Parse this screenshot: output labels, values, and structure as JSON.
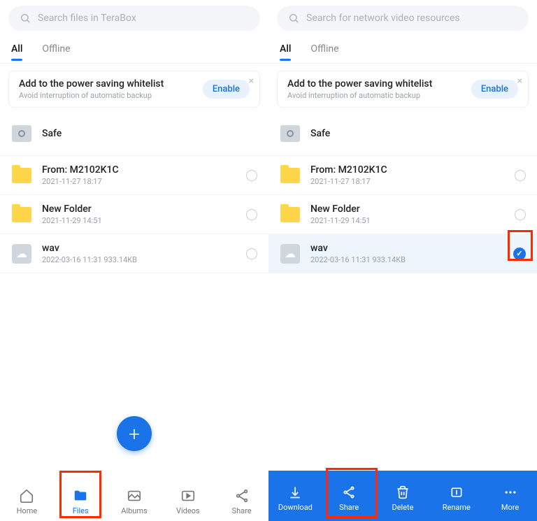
{
  "left": {
    "search_placeholder": "Search files in TeraBox",
    "tabs": {
      "all": "All",
      "offline": "Offline"
    },
    "banner": {
      "title": "Add to the power saving whitelist",
      "subtitle": "Avoid interruption of automatic backup",
      "button": "Enable"
    },
    "safe": {
      "title": "Safe"
    },
    "items": [
      {
        "title": "From: M2102K1C",
        "meta": "2021-11-27  18:17"
      },
      {
        "title": "New Folder",
        "meta": "2021-11-29  14:51"
      },
      {
        "title": "wav",
        "meta": "2022-03-16  11:31  933.14KB"
      }
    ],
    "nav": {
      "home": "Home",
      "files": "Files",
      "albums": "Albums",
      "videos": "Videos",
      "share": "Share"
    }
  },
  "right": {
    "search_placeholder": "Search for network video resources",
    "tabs": {
      "all": "All",
      "offline": "Offline"
    },
    "banner": {
      "title": "Add to the power saving whitelist",
      "subtitle": "Avoid interruption of automatic backup",
      "button": "Enable"
    },
    "safe": {
      "title": "Safe"
    },
    "items": [
      {
        "title": "From: M2102K1C",
        "meta": "2021-11-27  18:17"
      },
      {
        "title": "New Folder",
        "meta": "2021-11-29  14:51"
      },
      {
        "title": "wav",
        "meta": "2022-03-16  11:31  933.14KB"
      }
    ],
    "actions": {
      "download": "Download",
      "share": "Share",
      "delete": "Delete",
      "rename": "Rename",
      "more": "More"
    }
  }
}
